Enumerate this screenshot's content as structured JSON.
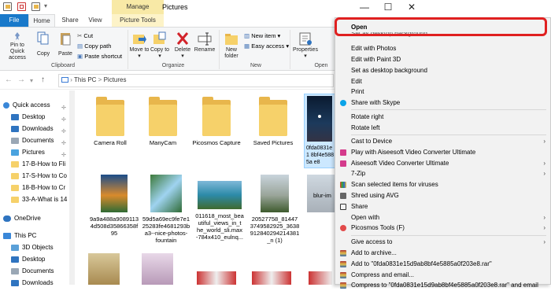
{
  "window": {
    "title": "Pictures",
    "controls": {
      "minimize": "—",
      "maximize": "☐",
      "close": "✕"
    },
    "context_tab": "Manage"
  },
  "tabs": {
    "file": "File",
    "home": "Home",
    "share": "Share",
    "view": "View",
    "picture_tools": "Picture Tools"
  },
  "ribbon": {
    "pin": "Pin to Quick access",
    "copy": "Copy",
    "paste": "Paste",
    "cut": "Cut",
    "copy_path": "Copy path",
    "paste_shortcut": "Paste shortcut",
    "move_to": "Move to",
    "copy_to": "Copy to",
    "delete": "Delete",
    "rename": "Rename",
    "new_folder": "New folder",
    "new_item": "New item",
    "easy_access": "Easy access",
    "properties": "Properties",
    "groups": {
      "clipboard": "Clipboard",
      "organize": "Organize",
      "new": "New",
      "open": "Open"
    }
  },
  "address": {
    "this_pc": "This PC",
    "separator": ">",
    "pictures": "Pictures"
  },
  "nav": {
    "quick_access": "Quick access",
    "desktop": "Desktop",
    "downloads": "Downloads",
    "documents": "Documents",
    "pictures": "Pictures",
    "f1": "17-B-How to Fli",
    "f2": "17-S-How to Co",
    "f3": "18-B-How to Cr",
    "f4": "33-A-What is 14",
    "onedrive": "OneDrive",
    "this_pc": "This PC",
    "objects": "3D Objects",
    "desktop2": "Desktop",
    "documents2": "Documents",
    "downloads2": "Downloads"
  },
  "files": {
    "camera_roll": "Camera Roll",
    "manycam": "ManyCam",
    "picosmos": "Picosmos Capture",
    "saved": "Saved Pictures",
    "selected": "0fda0831e1 8bf4e5885a e8",
    "img1": "9a9a488a9089113 4d508d35866358f 95",
    "img2": "59d5a69ec9fe7e1 25283fe4681293b a3--nice-photos- fountain",
    "img3": "011618_most_bea utiful_views_in_t he_world_sli.max -784x410_eulnq...",
    "img4": "20527758_81447 3749582925_3638 912840294214381 _n (1)",
    "img5": "blur-im"
  },
  "context_menu": {
    "open": "Open",
    "set_as_desktop": "Set as desktop background",
    "edit_photos": "Edit with Photos",
    "edit_paint3d": "Edit with Paint 3D",
    "set_bg": "Set as desktop background",
    "edit": "Edit",
    "print": "Print",
    "share_skype": "Share with Skype",
    "rotate_right": "Rotate right",
    "rotate_left": "Rotate left",
    "cast": "Cast to Device",
    "play_aiseesoft": "Play with Aiseesoft Video Converter Ultimate",
    "aiseesoft": "Aiseesoft Video Converter Ultimate",
    "zip": "7-Zip",
    "scan": "Scan selected items for viruses",
    "shred": "Shred using AVG",
    "share": "Share",
    "open_with": "Open with",
    "picosmos_tools": "Picosmos Tools (F)",
    "give_access": "Give access to",
    "add_archive": "Add to archive...",
    "add_rar": "Add to \"0fda0831e15d9ab8bf4e5885a0f203e8.rar\"",
    "compress_email": "Compress and email...",
    "compress_rar_email": "Compress to \"0fda0831e15d9ab8bf4e5885a0f203e8.rar\" and email"
  },
  "colors": {
    "accent": "#1979ca",
    "highlight_border": "#e02020",
    "folder": "#f6d16a",
    "menu_bg": "#f2f2f2"
  }
}
